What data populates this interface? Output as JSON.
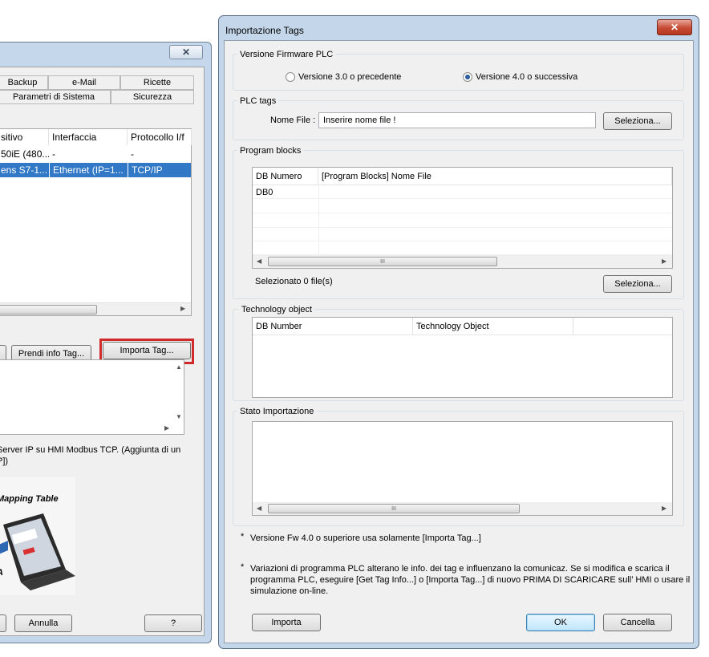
{
  "background_window": {
    "tabs_row1": [
      "Backup",
      "e-Mail",
      "Ricette"
    ],
    "tabs_row2": [
      "Parametri di Sistema",
      "Sicurezza"
    ],
    "close_label": "✕",
    "device_list": {
      "columns": [
        "sitivo",
        "Interfaccia",
        "Protocollo I/f"
      ],
      "rows": [
        [
          "50iE (480...",
          "-",
          "-"
        ],
        [
          "ens S7-1...",
          "Ethernet (IP=1...",
          "TCP/IP"
        ]
      ]
    },
    "buttons": {
      "get_info": "Prendi info Tag...",
      "import": "Importa Tag...",
      "cancel": "Annulla",
      "help": "?"
    },
    "description": "Server IP su HMI Modbus TCP. (Aggiunta di un\nP])",
    "image_caption": "Mapping Table",
    "image_letter": "A"
  },
  "dialog": {
    "title": "Importazione Tags",
    "close_label": "✕",
    "firmware": {
      "group_label": "Versione Firmware PLC",
      "option1": "Versione 3.0 o precedente",
      "option2": "Versione 4.0 o successiva",
      "selected": "option2"
    },
    "plc_tags": {
      "group_label": "PLC tags",
      "file_label": "Nome File :",
      "file_value": "Inserire nome file !",
      "select_button": "Seleziona..."
    },
    "program_blocks": {
      "group_label": "Program blocks",
      "columns": [
        "DB Numero",
        "[Program Blocks] Nome File"
      ],
      "rows": [
        [
          "DB0",
          ""
        ]
      ],
      "selected_text": "Selezionato 0 file(s)",
      "select_button": "Seleziona...",
      "scroll_grip": "III"
    },
    "technology": {
      "group_label": "Technology object",
      "columns": [
        "DB Number",
        "Technology Object"
      ]
    },
    "status": {
      "group_label": "Stato Importazione",
      "scroll_grip": "III"
    },
    "notes": {
      "bullet": "*",
      "note1": "Versione Fw 4.0 o superiore usa solamente [Importa Tag...]",
      "note2_line1": "Variazioni di programma PLC alterano le info. dei tag e influenzano la comunicaz. Se si modifica e scarica il",
      "note2_line2": "programma PLC, eseguire [Get Tag Info...] o [Importa Tag...] di nuovo PRIMA DI SCARICARE sull’ HMI o usare il",
      "note2_line3": "simulazione on-line."
    },
    "buttons": {
      "import": "Importa",
      "ok": "OK",
      "cancel": "Cancella"
    }
  },
  "colors": {
    "selection": "#3178c6",
    "highlight_box": "#d12a2a",
    "window_frame": "#c4d6ea"
  }
}
